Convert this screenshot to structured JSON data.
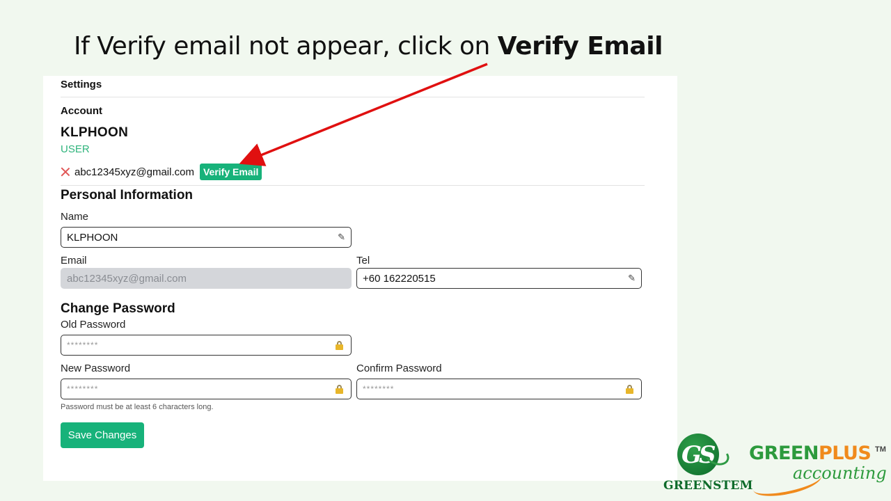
{
  "slide": {
    "instruction_prefix": "If Verify email not appear, click on ",
    "instruction_bold": "Verify Email"
  },
  "settings": {
    "title": "Settings",
    "account_title": "Account",
    "username": "KLPHOON",
    "role": "USER",
    "email": "abc12345xyz@gmail.com",
    "verify_button": "Verify Email",
    "verified_icon": "close-icon"
  },
  "personal": {
    "title": "Personal Information",
    "name_label": "Name",
    "name_value": "KLPHOON",
    "email_label": "Email",
    "email_value": "abc12345xyz@gmail.com",
    "tel_label": "Tel",
    "tel_value": "+60  162220515"
  },
  "password": {
    "title": "Change Password",
    "old_label": "Old Password",
    "old_placeholder": "********",
    "new_label": "New Password",
    "new_placeholder": "********",
    "confirm_label": "Confirm Password",
    "confirm_placeholder": "********",
    "hint": "Password must be at least 6 characters long."
  },
  "actions": {
    "save_label": "Save Changes"
  },
  "logos": {
    "greenstem_letters": "GS",
    "greenstem_name": "GREENSTEM",
    "greenplus_green": "GREEN",
    "greenplus_orange": "PLUS",
    "greenplus_tm": "TM",
    "greenplus_sub": "accounting"
  },
  "colors": {
    "accent": "#17b27a",
    "role": "#2fb47c",
    "arrow": "#e01010",
    "unverified": "#e05555"
  }
}
